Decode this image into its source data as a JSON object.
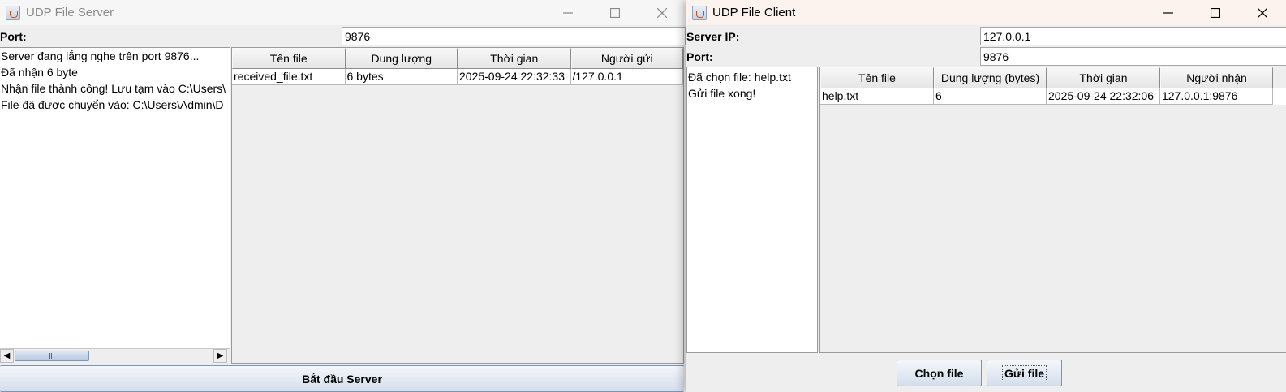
{
  "server": {
    "title": "UDP File Server",
    "port_label": "Port:",
    "port_value": "9876",
    "log_lines": [
      "Server đang lắng nghe trên port 9876...",
      "Đã nhận 6 byte",
      "Nhận file thành công! Lưu tạm vào C:\\Users\\",
      "File đã được chuyển vào: C:\\Users\\Admin\\D"
    ],
    "table_headers": [
      "Tên file",
      "Dung lượng",
      "Thời gian",
      "Người gửi"
    ],
    "table_rows": [
      [
        "received_file.txt",
        "6 bytes",
        "2025-09-24 22:32:33",
        "/127.0.0.1"
      ]
    ],
    "start_button": "Bắt đầu Server"
  },
  "client": {
    "title": "UDP File Client",
    "server_ip_label": "Server IP:",
    "server_ip_value": "127.0.0.1",
    "port_label": "Port:",
    "port_value": "9876",
    "log_lines": [
      "Đã chọn file: help.txt",
      "Gửi file xong!"
    ],
    "table_headers": [
      "Tên file",
      "Dung lượng (bytes)",
      "Thời gian",
      "Người nhận"
    ],
    "table_rows": [
      [
        "help.txt",
        "6",
        "2025-09-24 22:32:06",
        "127.0.0.1:9876"
      ]
    ],
    "choose_button": "Chọn file",
    "send_button": "Gửi file"
  },
  "icons": {
    "app": "java-cup-icon",
    "minimize": "minimize-icon",
    "maximize": "maximize-icon",
    "close": "close-icon"
  }
}
